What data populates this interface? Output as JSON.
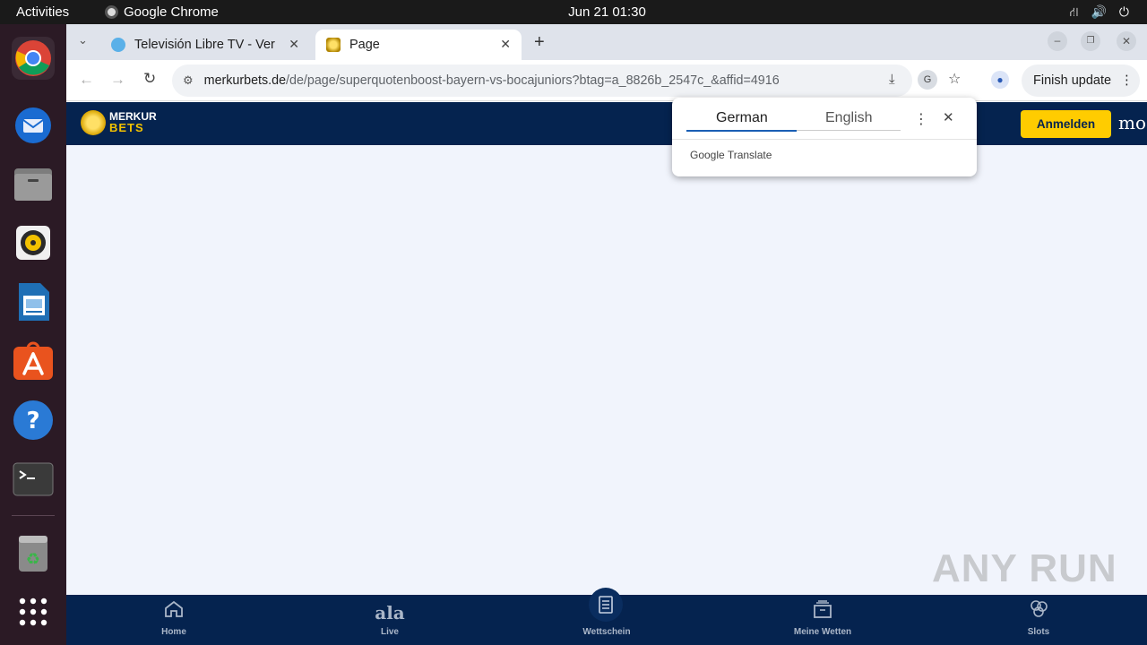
{
  "topbar": {
    "activities": "Activities",
    "app_name": "Google Chrome",
    "clock": "Jun 21  01:30"
  },
  "dock": {
    "apps": [
      "chrome-icon",
      "thunderbird-icon",
      "files-icon",
      "rhythmbox-icon",
      "writer-icon",
      "app-center-icon",
      "help-icon",
      "terminal-icon",
      "trash-icon",
      "app-grid-icon"
    ]
  },
  "browser": {
    "tabs": [
      {
        "title": "Televisión Libre TV - Ver"
      },
      {
        "title": "Page"
      }
    ],
    "url_host": "merkurbets.de",
    "url_path": "/de/page/superquotenboost-bayern-vs-bocajuniors?btag=a_8826b_2547c_&affid=4916",
    "finish_update": "Finish update"
  },
  "translate_popup": {
    "source_lang": "German",
    "target_lang": "English",
    "brand_google": "Google",
    "brand_translate": "Translate"
  },
  "site": {
    "logo_top": "MERKUR",
    "logo_bottom": "BETS",
    "login_button": "Anmelden",
    "more_text": "mo",
    "live_glyph": "ala"
  },
  "bottom_nav": {
    "home": "Home",
    "live": "Live",
    "wettschein": "Wettschein",
    "meine_wetten": "Meine Wetten",
    "slots": "Slots"
  },
  "watermark": "ANY RUN"
}
